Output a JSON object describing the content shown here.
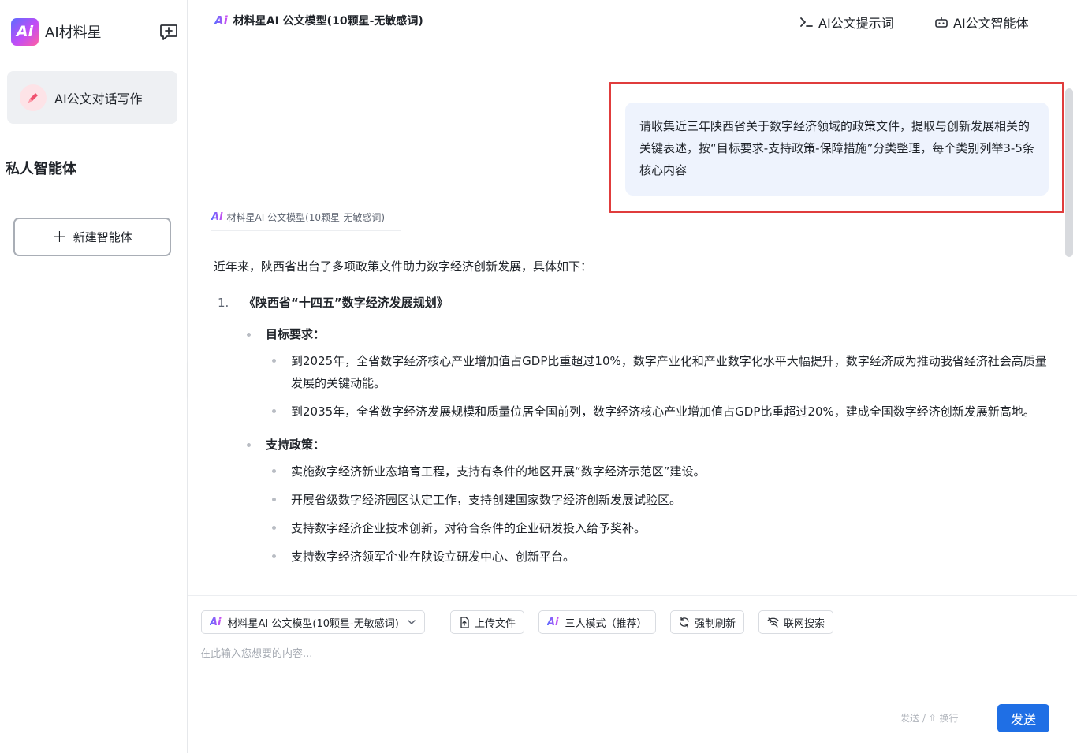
{
  "sidebar": {
    "brand_logo_text": "Ai",
    "brand_name": "AI材料星",
    "nav_active_label": "AI公文对话写作",
    "section_title": "私人智能体",
    "create_agent_label": "新建智能体"
  },
  "header": {
    "model_name": "材料星AI 公文模型(10颗星-无敏感词)",
    "link_prompts": "AI公文提示词",
    "link_agents": "AI公文智能体"
  },
  "chat": {
    "user_message": "请收集近三年陕西省关于数字经济领域的政策文件，提取与创新发展相关的关键表述，按“目标要求-支持政策-保障措施”分类整理，每个类别列举3-5条核心内容",
    "bot_model_label": "材料星AI 公文模型(10颗星-无敏感词)",
    "answer": {
      "intro": "近年来，陕西省出台了多项政策文件助力数字经济创新发展，具体如下：",
      "sections": [
        {
          "number": "1.",
          "title": "《陕西省“十四五”数字经济发展规划》",
          "groups": [
            {
              "title": "目标要求：",
              "items": [
                "到2025年，全省数字经济核心产业增加值占GDP比重超过10%，数字产业化和产业数字化水平大幅提升，数字经济成为推动我省经济社会高质量发展的关键动能。",
                "到2035年，全省数字经济发展规模和质量位居全国前列，数字经济核心产业增加值占GDP比重超过20%，建成全国数字经济创新发展新高地。"
              ]
            },
            {
              "title": "支持政策：",
              "items": [
                "实施数字经济新业态培育工程，支持有条件的地区开展“数字经济示范区”建设。",
                "开展省级数字经济园区认定工作，支持创建国家数字经济创新发展试验区。",
                "支持数字经济企业技术创新，对符合条件的企业研发投入给予奖补。",
                "支持数字经济领军企业在陕设立研发中心、创新平台。"
              ]
            }
          ]
        }
      ]
    }
  },
  "composer": {
    "model_select": "材料星AI 公文模型(10颗星-无敏感词)",
    "upload_label": "上传文件",
    "mode_label": "三人模式（推荐）",
    "refresh_label": "强制刷新",
    "web_search_label": "联网搜索",
    "placeholder": "在此输入您想要的内容...",
    "hint": "发送 / ⇧ 换行",
    "send_label": "发送"
  },
  "colors": {
    "accent": "#1f6fe5",
    "highlight": "#e03c3c",
    "user_bubble": "#eef3fd"
  }
}
